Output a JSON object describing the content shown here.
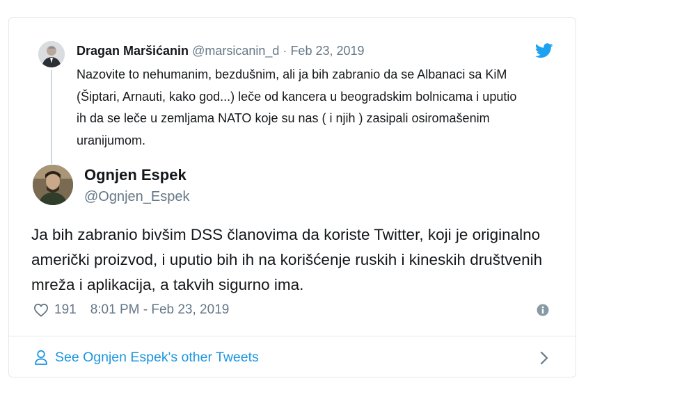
{
  "parent_tweet": {
    "name": "Dragan Maršićanin",
    "handle": "@marsicanin_d",
    "separator": "·",
    "date": "Feb 23, 2019",
    "text": "Nazovite to nehumanim, bezdušnim, ali ja bih zabranio da se Albanaci sa KiM (Šiptari, Arnauti, kako god...) leče od kancera u beogradskim bolnicama i uputio ih da se leče u zemljama NATO koje su nas ( i njih ) zasipali osiromašenim uranijumom."
  },
  "main_tweet": {
    "name": "Ognjen Espek",
    "handle": "@Ognjen_Espek",
    "text": "Ja bih zabranio bivšim DSS članovima da koriste Twitter, koji je originalno američki proizvod, i uputio bih ih na korišćenje ruskih i kineskih društvenih mreža i aplikacija, a takvih sigurno ima.",
    "likes": "191",
    "timestamp": "8:01 PM - Feb 23, 2019"
  },
  "footer": {
    "link_label": "See Ognjen Espek's other Tweets"
  },
  "icons": {
    "bird": "twitter-bird-icon",
    "heart": "heart-icon",
    "info": "info-icon",
    "person": "person-icon",
    "chevron": "chevron-right-icon"
  },
  "colors": {
    "accent": "#1da1f2",
    "link": "#1b95e0",
    "muted": "#657786",
    "border": "#e1e8ed"
  }
}
